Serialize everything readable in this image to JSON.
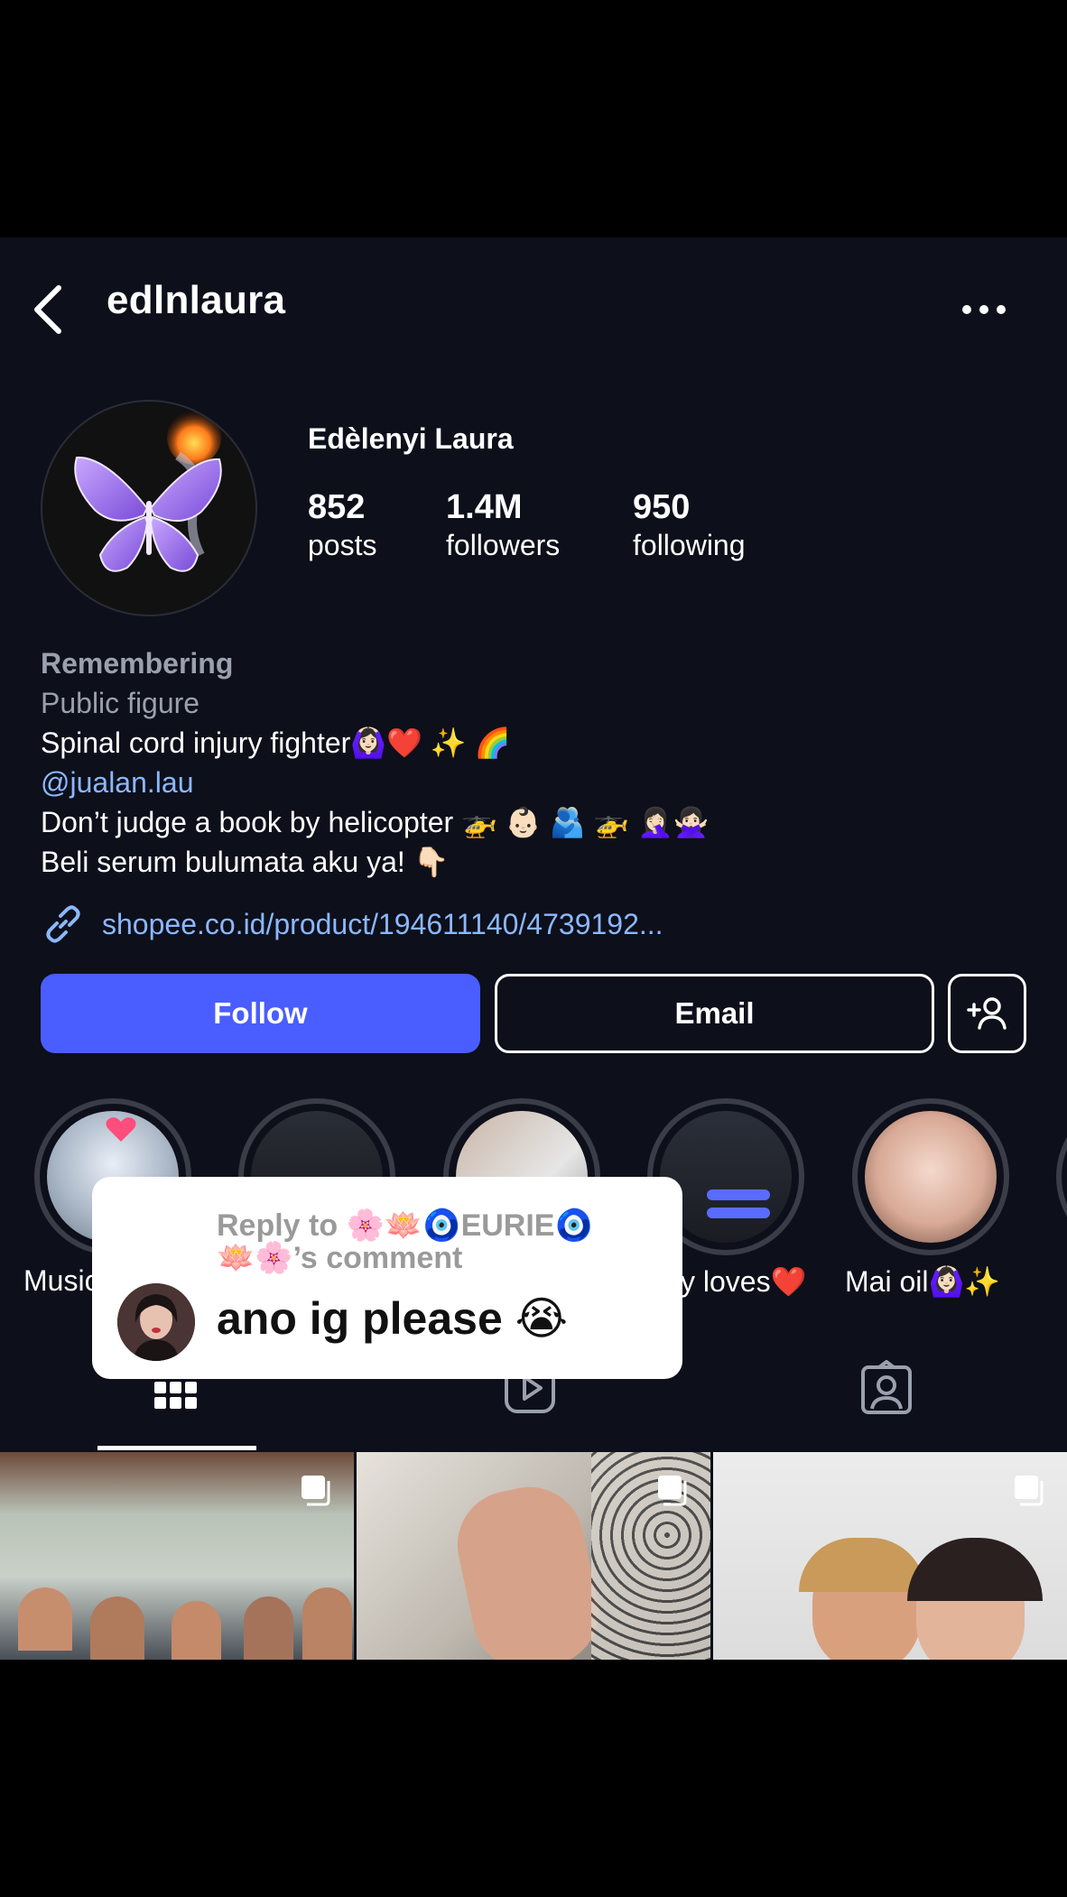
{
  "header": {
    "username": "edlnlaura"
  },
  "profile": {
    "display_name": "Edèlenyi Laura",
    "stats": [
      {
        "value": "852",
        "label": "posts"
      },
      {
        "value": "1.4M",
        "label": "followers"
      },
      {
        "value": "950",
        "label": "following"
      }
    ],
    "bio": {
      "remembering": "Remembering",
      "category": "Public figure",
      "line1": "Spinal cord injury fighter🙆🏻‍♀️❤️ ✨ 🌈",
      "mention": "@jualan.lau",
      "line2": "Don’t judge a book by helicopter 🚁 👶🏻 🫂 🚁 🤦🏻‍♀️🙅🏻‍♀️",
      "line3": "Beli serum bulumata aku ya! 👇🏻"
    },
    "link": "shopee.co.id/product/194611140/4739192..."
  },
  "actions": {
    "follow_label": "Follow",
    "email_label": "Email"
  },
  "highlights": [
    {
      "label": "Music"
    },
    {
      "label": ""
    },
    {
      "label": ""
    },
    {
      "label": "y loves❤️"
    },
    {
      "label": "Mai oil🙆🏻‍♀️✨"
    }
  ],
  "tabs": [
    {
      "icon": "grid-icon",
      "active": true
    },
    {
      "icon": "reels-icon",
      "active": false
    },
    {
      "icon": "tagged-icon",
      "active": false
    }
  ],
  "reply_overlay": {
    "header_line1": "Reply to 🌸🪷🧿EURIE🧿",
    "header_line2": "🪷🌸’s comment",
    "comment": "ano ig please 😭"
  },
  "colors": {
    "background": "#0d0f1a",
    "follow_button": "#4a5dff",
    "link": "#8ab8ff",
    "muted_text": "#9aa0ad"
  }
}
